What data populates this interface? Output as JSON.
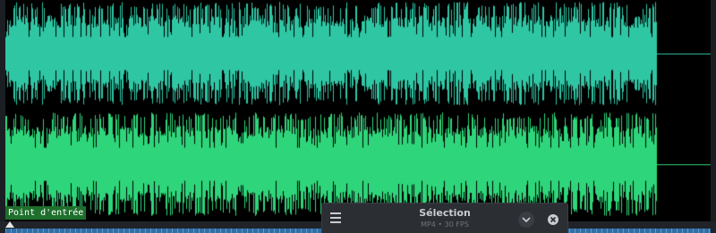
{
  "waveform": {
    "colors": {
      "top": "#2fc6a4",
      "bottom": "#2fd57a",
      "background": "#000000"
    },
    "channels": [
      "top",
      "bottom"
    ]
  },
  "marker": {
    "in_label": "Point d'entrée"
  },
  "selection_panel": {
    "title": "Sélection",
    "subtitle": "MP4 • 30 FPS",
    "menu_icon": "hamburger-icon",
    "expand_icon": "chevron-down-icon",
    "close_icon": "close-circle-icon"
  },
  "timeline": {
    "accent": "#2f6fa8"
  }
}
